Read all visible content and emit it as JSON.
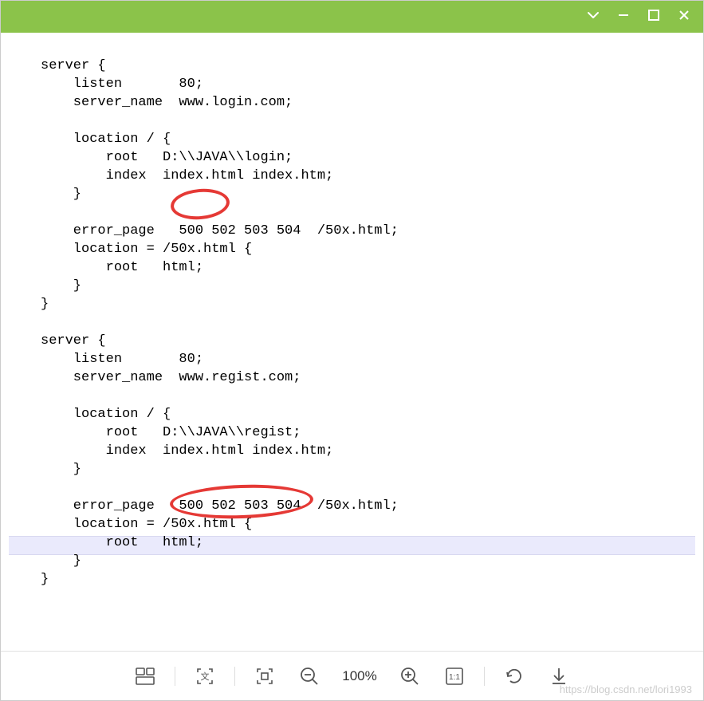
{
  "code_text": "server {\n    listen       80;\n    server_name  www.login.com;\n\n    location / {\n        root   D:\\\\JAVA\\\\login;\n        index  index.html index.htm;\n    }\n\n    error_page   500 502 503 504  /50x.html;\n    location = /50x.html {\n        root   html;\n    }\n}\n\nserver {\n    listen       80;\n    server_name  www.regist.com;\n\n    location / {\n        root   D:\\\\JAVA\\\\regist;\n        index  index.html index.htm;\n    }\n\n    error_page   500 502 503 504  /50x.html;\n    location = /50x.html {\n        root   html;\n    }\n}",
  "zoom_level": "100%",
  "watermark": "https://blog.csdn.net/lori1993"
}
